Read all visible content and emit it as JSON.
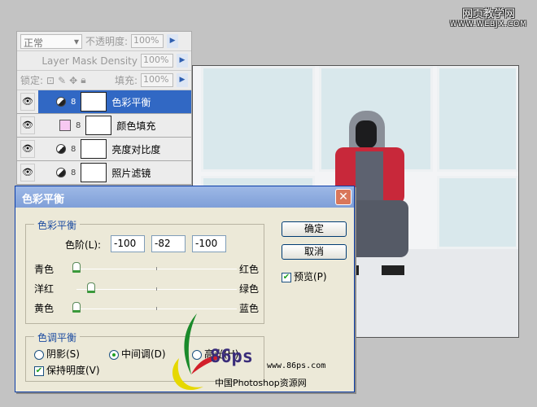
{
  "watermark": {
    "line1": "网页教学网",
    "line2": "WWW.WEBJX.COM"
  },
  "layers_panel": {
    "blend_mode": "正常",
    "opacity_label": "不透明度:",
    "opacity": "100%",
    "mask_density_label": "Layer Mask Density",
    "mask_density": "100%",
    "lock_label": "锁定:",
    "fill_label": "填充:",
    "fill": "100%",
    "layers": [
      {
        "name": "色彩平衡",
        "active": true,
        "type": "adjustment"
      },
      {
        "name": "颜色填充",
        "type": "fill",
        "swatch": "#f7c8f2"
      },
      {
        "name": "亮度对比度",
        "type": "adjustment"
      },
      {
        "name": "照片滤镜",
        "type": "adjustment"
      }
    ]
  },
  "dialog": {
    "title": "色彩平衡",
    "color_balance_group": "色彩平衡",
    "levels_label": "色阶(L):",
    "levels": [
      "-100",
      "-82",
      "-100"
    ],
    "sliders": [
      {
        "left": "青色",
        "right": "红色",
        "value": -100
      },
      {
        "left": "洋红",
        "right": "绿色",
        "value": -82
      },
      {
        "left": "黄色",
        "right": "蓝色",
        "value": -100
      }
    ],
    "tone_group": "色调平衡",
    "tones": [
      {
        "label": "阴影(S)",
        "checked": false
      },
      {
        "label": "中间调(D)",
        "checked": true
      },
      {
        "label": "高光(H)",
        "checked": false
      }
    ],
    "preserve_luminosity": "保持明度(V)",
    "ok": "确定",
    "cancel": "取消",
    "preview": "预览(P)"
  },
  "logo": {
    "brand": "86ps",
    "url": "www.86ps.com",
    "tagline": "中国Photoshop资源网"
  }
}
